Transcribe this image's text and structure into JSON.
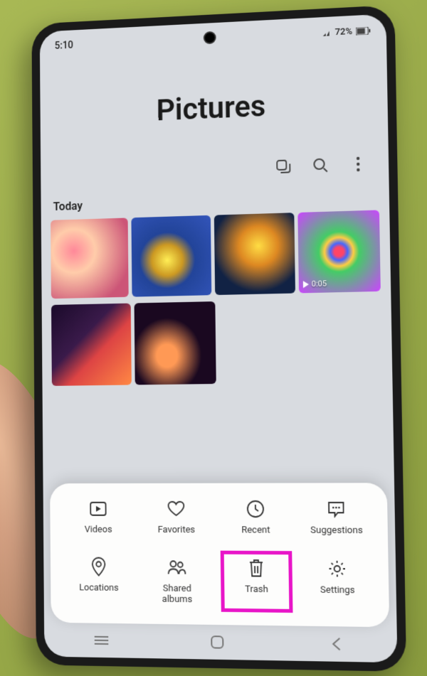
{
  "status": {
    "time": "5:10",
    "battery": "72%"
  },
  "header": {
    "title": "Pictures"
  },
  "section": {
    "today": "Today"
  },
  "video": {
    "duration": "0:05"
  },
  "menu": {
    "videos": "Videos",
    "favorites": "Favorites",
    "recent": "Recent",
    "suggestions": "Suggestions",
    "locations": "Locations",
    "shared_albums": "Shared\nalbums",
    "trash": "Trash",
    "settings": "Settings"
  }
}
